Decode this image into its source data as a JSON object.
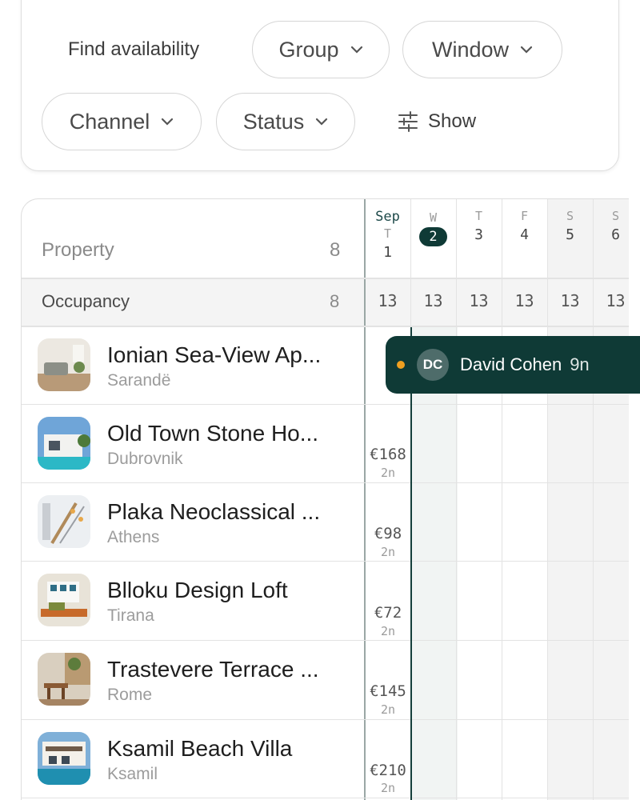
{
  "filters": {
    "find_label": "Find availability",
    "group_label": "Group",
    "window_label": "Window",
    "channel_label": "Channel",
    "status_label": "Status",
    "show_label": "Show"
  },
  "grid": {
    "property_header": "Property",
    "property_count": "8",
    "occupancy_label": "Occupancy",
    "occupancy_count": "8",
    "month": "Sep",
    "days": [
      {
        "dow": "T",
        "num": "1",
        "occ": "13"
      },
      {
        "dow": "W",
        "num": "2",
        "occ": "13",
        "today": true
      },
      {
        "dow": "T",
        "num": "3",
        "occ": "13"
      },
      {
        "dow": "F",
        "num": "4",
        "occ": "13"
      },
      {
        "dow": "S",
        "num": "5",
        "occ": "13"
      },
      {
        "dow": "S",
        "num": "6",
        "occ": "13"
      }
    ],
    "properties": [
      {
        "name": "Ionian Sea-View Ap...",
        "city": "Sarandë",
        "price": "",
        "nights": ""
      },
      {
        "name": "Old Town Stone Ho...",
        "city": "Dubrovnik",
        "price": "€168",
        "nights": "2n"
      },
      {
        "name": "Plaka Neoclassical ...",
        "city": "Athens",
        "price": "€98",
        "nights": "2n"
      },
      {
        "name": "Blloku Design Loft",
        "city": "Tirana",
        "price": "€72",
        "nights": "2n"
      },
      {
        "name": "Trastevere Terrace ...",
        "city": "Rome",
        "price": "€145",
        "nights": "2n"
      },
      {
        "name": "Ksamil Beach Villa",
        "city": "Ksamil",
        "price": "€210",
        "nights": "2n"
      }
    ],
    "booking": {
      "initials": "DC",
      "guest": "David Cohen",
      "nights": "9n"
    }
  },
  "colors": {
    "accent": "#0f3a36",
    "dot": "#f0a020"
  }
}
